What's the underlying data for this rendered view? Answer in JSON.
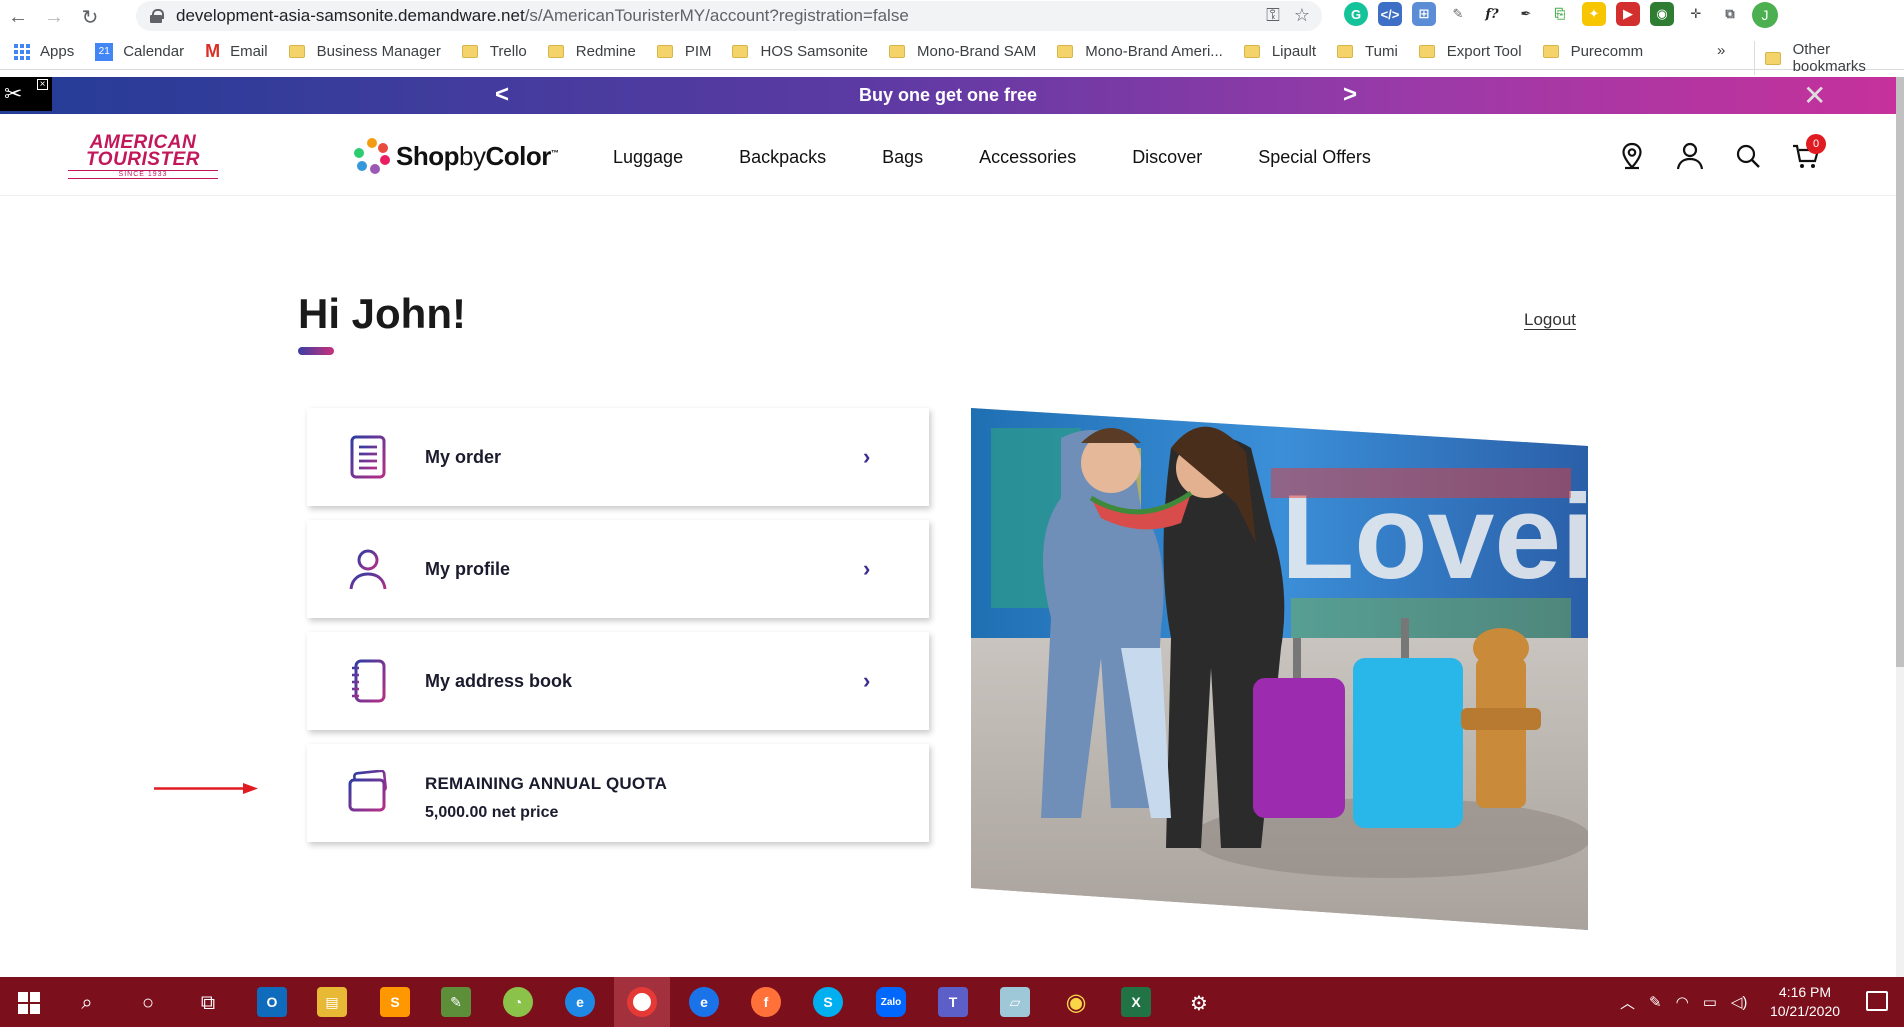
{
  "browser": {
    "url_host": "development-asia-samsonite.demandware.net",
    "url_path": "/s/AmericanTouristerMY/account?registration=false",
    "profile_initial": "J",
    "bookmarks": [
      "Apps",
      "Calendar",
      "Email",
      "Business Manager",
      "Trello",
      "Redmine",
      "PIM",
      "HOS Samsonite",
      "Mono-Brand SAM",
      "Mono-Brand Ameri...",
      "Lipault",
      "Tumi",
      "Export Tool",
      "Purecomm"
    ],
    "calendar_day": "21",
    "more_bookmarks": "»",
    "other_bookmarks": "Other bookmarks"
  },
  "promo": {
    "text": "Buy one get one free",
    "prev": "<",
    "next": ">",
    "close": "✕",
    "bg_start": "#233d96",
    "bg_end": "#c6319b"
  },
  "header": {
    "logo_line1": "AMERICAN",
    "logo_line2": "TOURISTER",
    "logo_since": "SINCE 1933",
    "sbc_shop": "Shop",
    "sbc_by": "by",
    "sbc_color": "Color",
    "sbc_tm": "™",
    "nav": [
      "Luggage",
      "Backpacks",
      "Bags",
      "Accessories",
      "Discover",
      "Special Offers"
    ],
    "cart_count": "0",
    "brand_color": "#c2185b"
  },
  "account": {
    "greeting": "Hi John!",
    "logout": "Logout",
    "cards": [
      {
        "label": "My order",
        "icon": "order-list-icon"
      },
      {
        "label": "My profile",
        "icon": "user-icon"
      },
      {
        "label": "My address book",
        "icon": "address-book-icon"
      }
    ],
    "quota": {
      "title": "REMAINING ANNUAL QUOTA",
      "value": "5,000.00 net price",
      "icon": "credit-card-icon"
    },
    "chevron": "›",
    "annotation_color": "#e11b22"
  },
  "taskbar": {
    "time": "4:16 PM",
    "date": "10/21/2020",
    "bg_color": "#7c0f1c"
  }
}
